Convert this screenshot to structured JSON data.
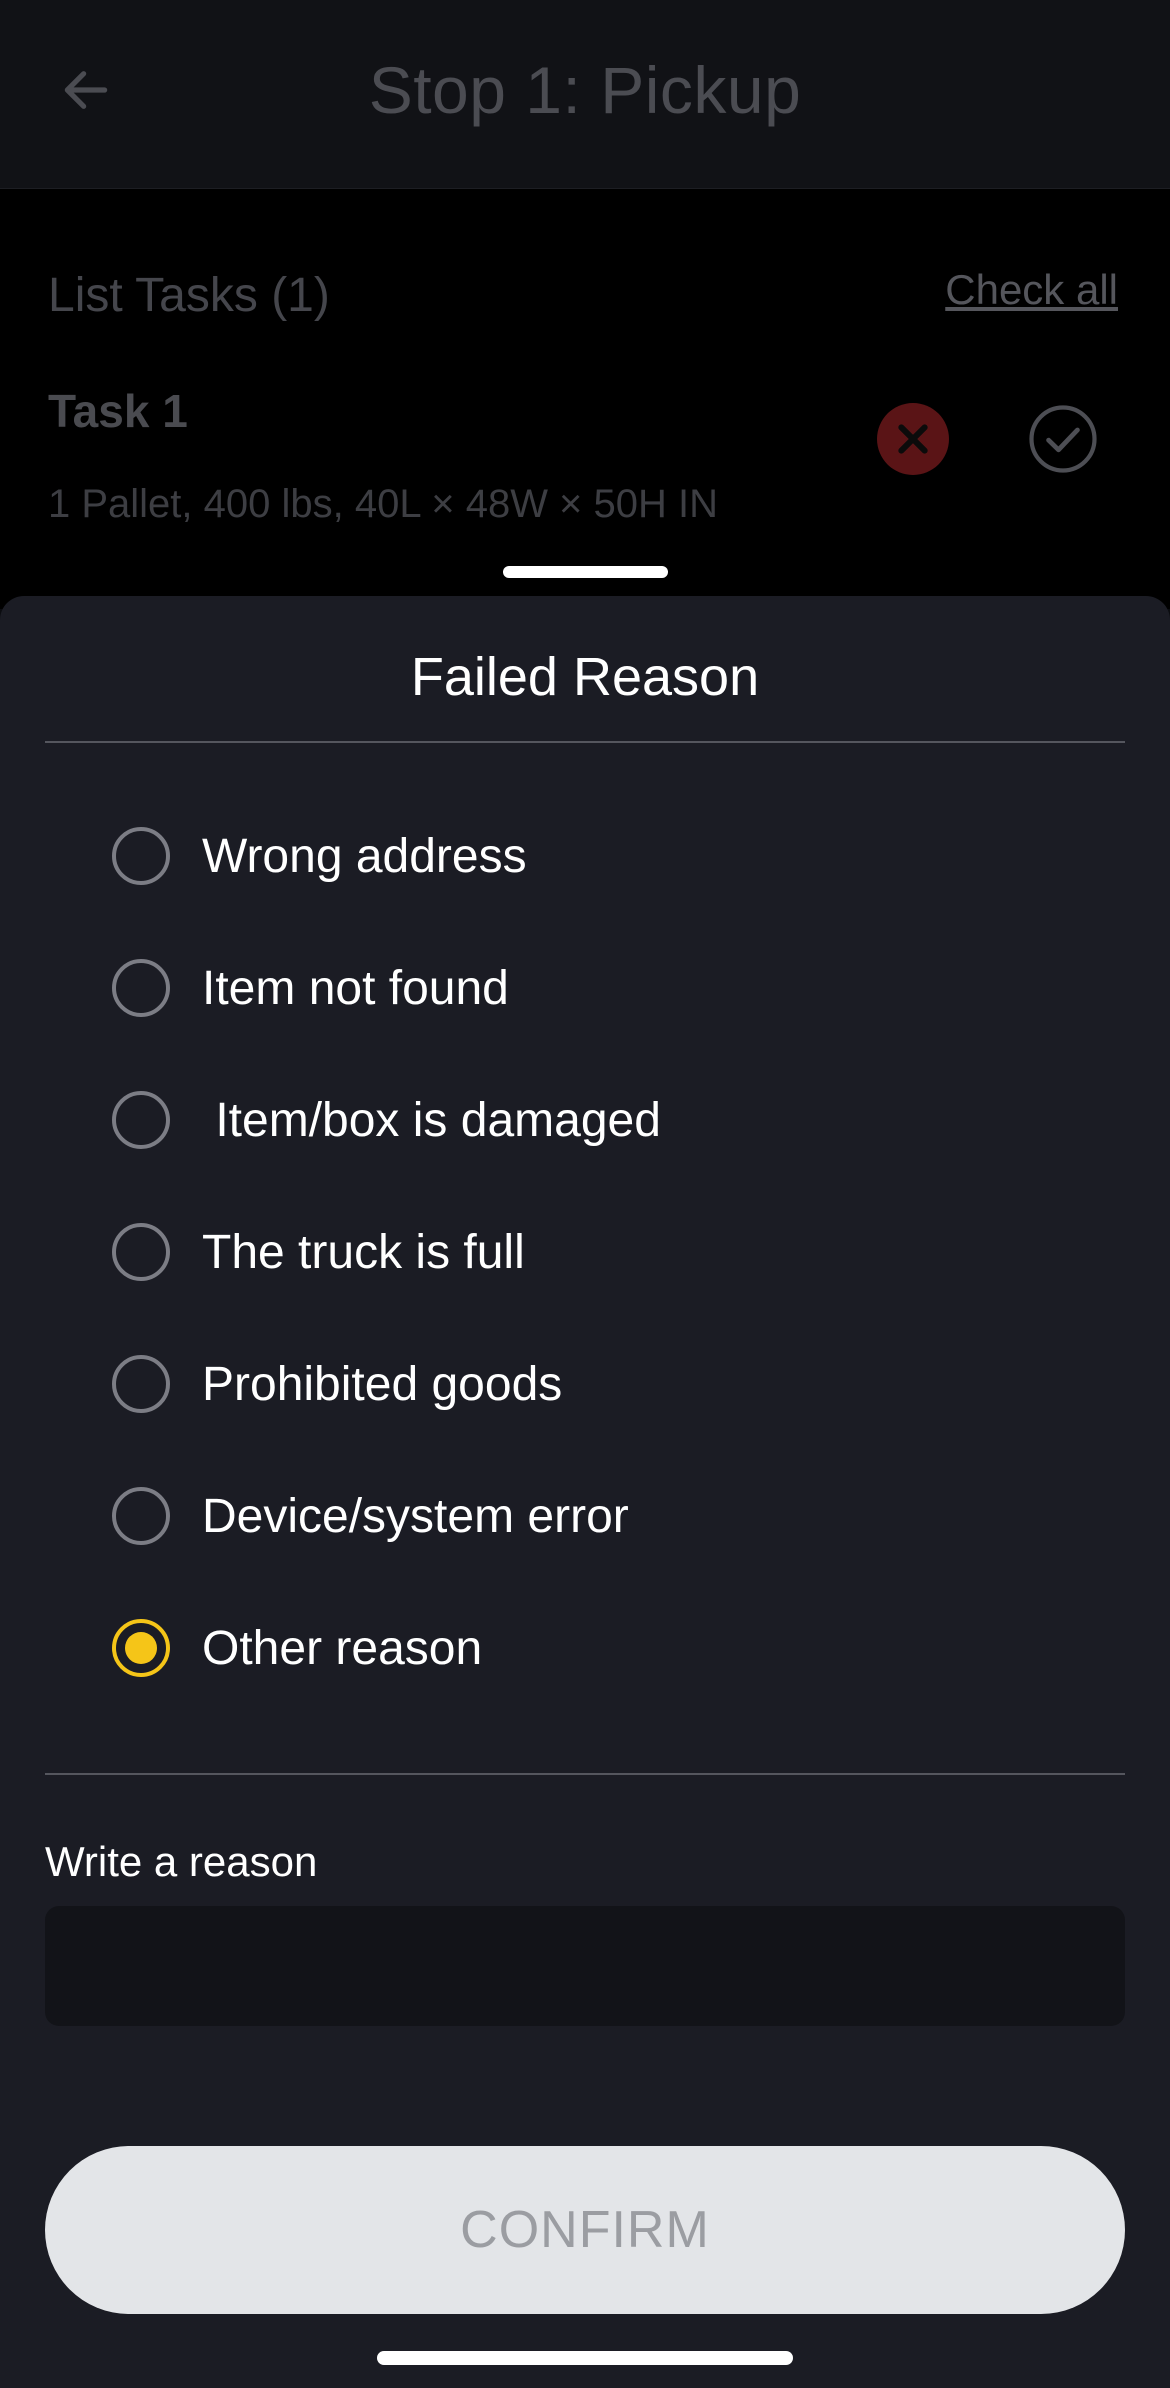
{
  "header": {
    "title": "Stop 1: Pickup",
    "back_icon": "arrow-left-icon"
  },
  "tasks": {
    "heading": "List Tasks (1)",
    "check_all_label": "Check all",
    "items": [
      {
        "title": "Task 1",
        "description": "1 Pallet, 400 lbs, 40L × 48W × 50H IN",
        "fail_icon": "close-icon",
        "done_icon": "check-circle-icon"
      }
    ]
  },
  "sheet": {
    "title": "Failed Reason",
    "options": [
      {
        "label": "Wrong address",
        "selected": false
      },
      {
        "label": "Item not found",
        "selected": false
      },
      {
        "label": " Item/box is damaged",
        "selected": false
      },
      {
        "label": "The truck is full",
        "selected": false
      },
      {
        "label": "Prohibited goods",
        "selected": false
      },
      {
        "label": "Device/system error",
        "selected": false
      },
      {
        "label": "Other reason",
        "selected": true
      }
    ],
    "reason_label": "Write a reason",
    "reason_value": "",
    "reason_placeholder": "",
    "confirm_label": "CONFIRM"
  },
  "colors": {
    "accent": "#f5c518",
    "sheet_background": "#1b1c24",
    "fail_red": "#5a1416"
  }
}
